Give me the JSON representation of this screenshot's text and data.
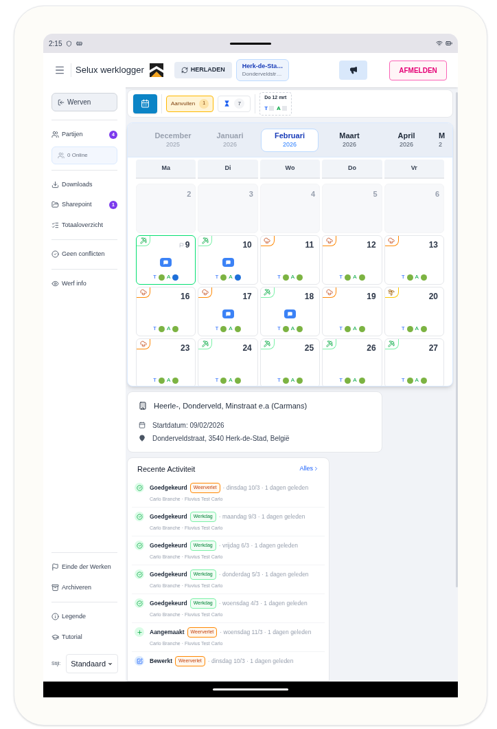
{
  "status_bar": {
    "time": "2:15"
  },
  "header": {
    "app_title": "Selux werklogger",
    "reload": "HERLADEN",
    "location": {
      "title": "Herk-de-Sta…",
      "subtitle": "Donderveldstr…"
    },
    "logout": "AFMELDEN"
  },
  "sidebar": {
    "back": "Werven",
    "top_groups": [
      [
        {
          "kind": "item",
          "label": "Partijen",
          "badge": "4"
        },
        {
          "kind": "chip",
          "label": "0 Online"
        }
      ],
      [
        {
          "kind": "item",
          "label": "Downloads"
        },
        {
          "kind": "item",
          "label": "Sharepoint",
          "badge": "1"
        },
        {
          "kind": "item",
          "label": "Totaaloverzicht"
        }
      ],
      [
        {
          "kind": "item",
          "label": "Geen conflicten"
        }
      ],
      [
        {
          "kind": "item",
          "label": "Werf info"
        }
      ]
    ],
    "bottom_groups": [
      [
        {
          "kind": "item",
          "label": "Einde der Werken"
        },
        {
          "kind": "item",
          "label": "Archiveren"
        }
      ],
      [
        {
          "kind": "item",
          "label": "Legende"
        },
        {
          "kind": "item",
          "label": "Tutorial"
        }
      ]
    ],
    "style_label": "Stijl:",
    "style_value": "Standaard"
  },
  "toolbar": {
    "fill_in": {
      "label": "Aanvullen",
      "count": "1"
    },
    "pending_count": "7",
    "next_day": {
      "label": "Do 12 mrt",
      "t": "T",
      "a": "A"
    }
  },
  "months": [
    {
      "name": "December",
      "year": "2025",
      "selected": false,
      "past": true
    },
    {
      "name": "Januari",
      "year": "2026",
      "selected": false,
      "past": true
    },
    {
      "name": "Februari",
      "year": "2026",
      "selected": true,
      "past": false
    },
    {
      "name": "Maart",
      "year": "2026",
      "selected": false,
      "past": false
    },
    {
      "name": "April",
      "year": "2026",
      "selected": false,
      "past": false
    },
    {
      "name": "M",
      "year": "2",
      "selected": false,
      "past": false
    }
  ],
  "weekdays": [
    "Ma",
    "Di",
    "Wo",
    "Do",
    "Vr"
  ],
  "weeks": [
    [
      {
        "day": "2",
        "kind": "empty",
        "selected": false
      },
      {
        "day": "3",
        "kind": "empty",
        "selected": false
      },
      {
        "day": "4",
        "kind": "empty",
        "selected": false
      },
      {
        "day": "5",
        "kind": "empty",
        "selected": false
      },
      {
        "day": "6",
        "kind": "empty",
        "selected": false
      }
    ],
    [
      {
        "day": "9",
        "kind": "work",
        "selected": true,
        "flag": true,
        "comment": true,
        "t": {
          "label": "T",
          "color": "#7cb342"
        },
        "a": {
          "label": "A",
          "color": "#1e6fd9"
        }
      },
      {
        "day": "10",
        "kind": "work",
        "selected": false,
        "flag": false,
        "comment": true,
        "t": {
          "label": "T",
          "color": "#7cb342"
        },
        "a": {
          "label": "A",
          "color": "#1e6fd9"
        }
      },
      {
        "day": "11",
        "kind": "rain",
        "selected": false,
        "flag": false,
        "comment": false,
        "t": {
          "label": "T",
          "color": "#7cb342"
        },
        "a": {
          "label": "A",
          "color": "#7cb342"
        }
      },
      {
        "day": "12",
        "kind": "rain",
        "selected": false,
        "flag": false,
        "comment": false,
        "t": {
          "label": "T",
          "color": "#7cb342"
        },
        "a": {
          "label": "A",
          "color": "#7cb342"
        }
      },
      {
        "day": "13",
        "kind": "rain",
        "selected": false,
        "flag": false,
        "comment": false,
        "t": {
          "label": "T",
          "color": "#7cb342"
        },
        "a": {
          "label": "A",
          "color": "#7cb342"
        }
      }
    ],
    [
      {
        "day": "16",
        "kind": "rain",
        "selected": false,
        "flag": false,
        "comment": false,
        "t": {
          "label": "T",
          "color": "#7cb342"
        },
        "a": {
          "label": "A",
          "color": "#7cb342"
        }
      },
      {
        "day": "17",
        "kind": "rain",
        "selected": false,
        "flag": false,
        "comment": true,
        "t": {
          "label": "T",
          "color": "#7cb342"
        },
        "a": {
          "label": "A",
          "color": "#7cb342"
        }
      },
      {
        "day": "18",
        "kind": "work",
        "selected": false,
        "flag": false,
        "comment": true,
        "t": {
          "label": "T",
          "color": "#7cb342"
        },
        "a": {
          "label": "A",
          "color": "#7cb342"
        }
      },
      {
        "day": "19",
        "kind": "rain",
        "selected": false,
        "flag": false,
        "comment": false,
        "t": {
          "label": "T",
          "color": "#7cb342"
        },
        "a": {
          "label": "A",
          "color": "#7cb342"
        }
      },
      {
        "day": "20",
        "kind": "holiday",
        "selected": false,
        "flag": false,
        "comment": false,
        "t": {
          "label": "T",
          "color": "#7cb342"
        },
        "a": {
          "label": "A",
          "color": "#7cb342"
        }
      }
    ],
    [
      {
        "day": "23",
        "kind": "rain",
        "selected": false,
        "flag": false,
        "comment": false,
        "t": {
          "label": "T",
          "color": "#7cb342"
        },
        "a": {
          "label": "A",
          "color": "#7cb342"
        }
      },
      {
        "day": "24",
        "kind": "work",
        "selected": false,
        "flag": false,
        "comment": false,
        "t": {
          "label": "T",
          "color": "#7cb342"
        },
        "a": {
          "label": "A",
          "color": "#7cb342"
        }
      },
      {
        "day": "25",
        "kind": "work",
        "selected": false,
        "flag": false,
        "comment": false,
        "t": {
          "label": "T",
          "color": "#7cb342"
        },
        "a": {
          "label": "A",
          "color": "#7cb342"
        }
      },
      {
        "day": "26",
        "kind": "work",
        "selected": false,
        "flag": false,
        "comment": false,
        "t": {
          "label": "T",
          "color": "#7cb342"
        },
        "a": {
          "label": "A",
          "color": "#7cb342"
        }
      },
      {
        "day": "27",
        "kind": "work",
        "selected": false,
        "flag": false,
        "comment": false,
        "t": {
          "label": "T",
          "color": "#7cb342"
        },
        "a": {
          "label": "A",
          "color": "#7cb342"
        }
      }
    ]
  ],
  "project": {
    "title": "Heerle-, Donderveld, Minstraat e.a (Carmans)",
    "start": "Startdatum: 09/02/2026",
    "address": "Donderveldstraat, 3540 Herk-de-Stad, België"
  },
  "activity": {
    "title": "Recente Activiteit",
    "all": "Alles",
    "items": [
      {
        "kind": "approved",
        "action": "Goedgekeurd",
        "tag": {
          "kind": "weather",
          "label": "Weerverlet"
        },
        "meta": "· dinsdag 10/3 · 1 dagen geleden",
        "sub": "Carlo Branche · Fluvius Test Carlo"
      },
      {
        "kind": "approved",
        "action": "Goedgekeurd",
        "tag": {
          "kind": "work",
          "label": "Werkdag"
        },
        "meta": "· maandag 9/3 · 1 dagen geleden",
        "sub": "Carlo Branche · Fluvius Test Carlo"
      },
      {
        "kind": "approved",
        "action": "Goedgekeurd",
        "tag": {
          "kind": "work",
          "label": "Werkdag"
        },
        "meta": "· vrijdag 6/3 · 1 dagen geleden",
        "sub": "Carlo Branche · Fluvius Test Carlo"
      },
      {
        "kind": "approved",
        "action": "Goedgekeurd",
        "tag": {
          "kind": "work",
          "label": "Werkdag"
        },
        "meta": "· donderdag 5/3 · 1 dagen geleden",
        "sub": "Carlo Branche · Fluvius Test Carlo"
      },
      {
        "kind": "approved",
        "action": "Goedgekeurd",
        "tag": {
          "kind": "work",
          "label": "Werkdag"
        },
        "meta": "· woensdag 4/3 · 1 dagen geleden",
        "sub": "Carlo Branche · Fluvius Test Carlo"
      },
      {
        "kind": "created",
        "action": "Aangemaakt",
        "tag": {
          "kind": "weather",
          "label": "Weerverlet"
        },
        "meta": "· woensdag 11/3 · 1 dagen geleden",
        "sub": "Carlo Branche · Fluvius Test Carlo"
      },
      {
        "kind": "edited",
        "action": "Bewerkt",
        "tag": {
          "kind": "weather",
          "label": "Weerverlet"
        },
        "meta": "· dinsdag 10/3 · 1 dagen geleden"
      }
    ]
  }
}
